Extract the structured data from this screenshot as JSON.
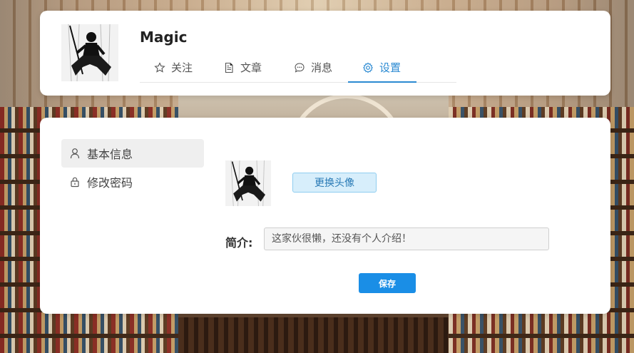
{
  "profile": {
    "username": "Magic",
    "avatar_icon": "ninja-avatar"
  },
  "tabs": [
    {
      "label": "关注",
      "icon": "star-icon"
    },
    {
      "label": "文章",
      "icon": "document-icon"
    },
    {
      "label": "消息",
      "icon": "chat-icon"
    },
    {
      "label": "设置",
      "icon": "gear-icon",
      "active": true
    }
  ],
  "sidebar": {
    "items": [
      {
        "label": "基本信息",
        "icon": "user-icon",
        "active": true
      },
      {
        "label": "修改密码",
        "icon": "lock-icon"
      }
    ]
  },
  "settings": {
    "change_avatar_label": "更换头像",
    "bio_label": "简介:",
    "bio_placeholder": "这家伙很懒，还没有个人介绍！",
    "save_label": "保存"
  },
  "colors": {
    "accent": "#2b8ad2",
    "save_button": "#1a8ee6",
    "avatar_button_bg": "#d7eefb"
  }
}
